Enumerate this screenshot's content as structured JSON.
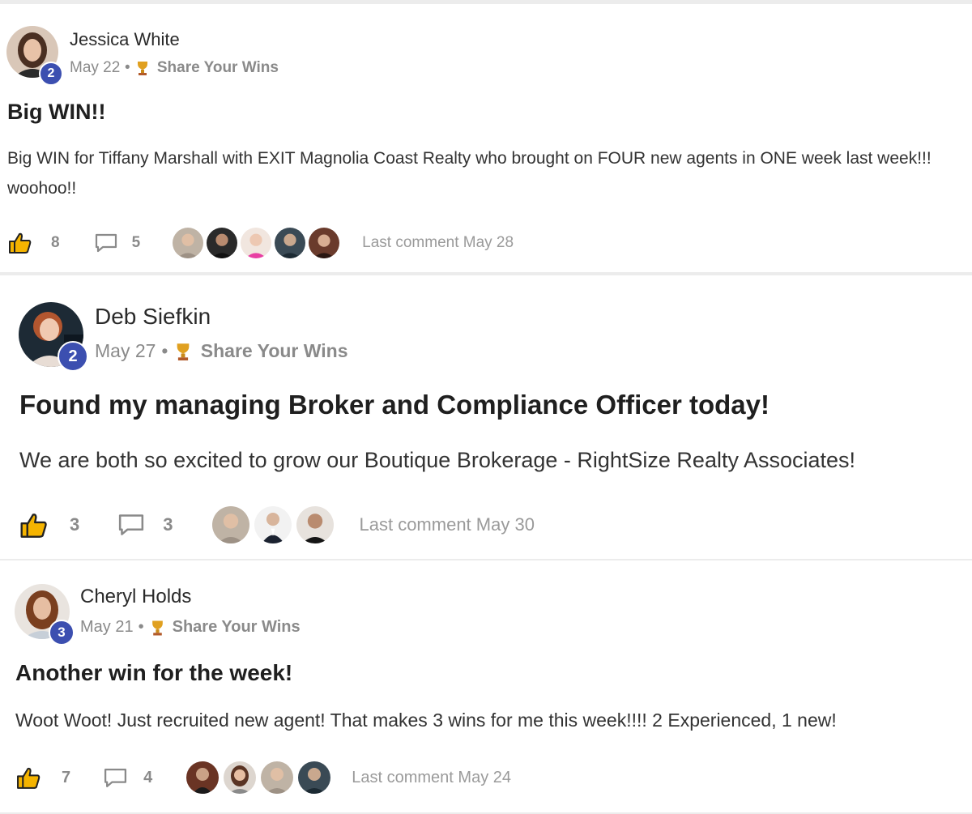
{
  "posts": [
    {
      "author": "Jessica White",
      "level": "2",
      "date": "May 22",
      "dot": "•",
      "category": "Share Your Wins",
      "title": "Big WIN!!",
      "body": "Big WIN for Tiffany Marshall with EXIT Magnolia Coast Realty who brought on FOUR new agents in ONE week last week!!! woohoo!!",
      "likes": "8",
      "comments": "5",
      "last_comment": "Last comment May 28",
      "commenter_avatar_count": 5
    },
    {
      "author": "Deb Siefkin",
      "level": "2",
      "date": "May 27",
      "dot": "•",
      "category": "Share Your Wins",
      "title": "Found my managing Broker and Compliance Officer today!",
      "body": "We are both so excited to grow our Boutique Brokerage - RightSize Realty Associates!",
      "likes": "3",
      "comments": "3",
      "last_comment": "Last comment May 30",
      "commenter_avatar_count": 3
    },
    {
      "author": "Cheryl Holds",
      "level": "3",
      "date": "May 21",
      "dot": "•",
      "category": "Share Your Wins",
      "title": "Another win for the week!",
      "body": "Woot Woot! Just recruited new agent! That makes 3 wins for me this week!!!! 2 Experienced, 1 new!",
      "likes": "7",
      "comments": "4",
      "last_comment": "Last comment May 24",
      "commenter_avatar_count": 4
    }
  ],
  "icons": {
    "like": "thumbs-up-icon",
    "comment": "comment-bubble-icon",
    "category": "trophy-icon"
  },
  "colors": {
    "level_badge": "#3c4fb0",
    "like_icon": "#f5b400",
    "trophy_icon": "#e0a020"
  }
}
